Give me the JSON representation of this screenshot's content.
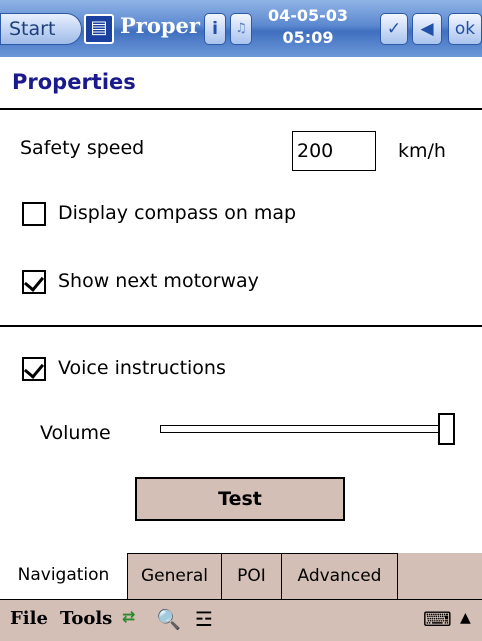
{
  "titlebar": {
    "start_label": "Start",
    "app_title": "Proper",
    "date": "04-05-03",
    "time": "05:09",
    "info_label": "i",
    "ok_label": "ok",
    "app_icon": "app-icon",
    "volume_icon": "speaker-icon",
    "back_icon": "back-arrow-icon",
    "check_icon": "tasks-icon"
  },
  "page": {
    "title": "Properties"
  },
  "settings": {
    "safety_speed_label": "Safety speed",
    "safety_speed_value": "200",
    "safety_speed_unit": "km/h",
    "display_compass_label": "Display compass on map",
    "display_compass_checked": false,
    "show_motorway_label": "Show next motorway",
    "show_motorway_checked": true,
    "voice_instructions_label": "Voice instructions",
    "voice_instructions_checked": true,
    "volume_label": "Volume",
    "volume_level": 1.0,
    "test_button_label": "Test"
  },
  "tabs": [
    {
      "label": "Navigation",
      "active": true
    },
    {
      "label": "General",
      "active": false
    },
    {
      "label": "POI",
      "active": false
    },
    {
      "label": "Advanced",
      "active": false
    }
  ],
  "menubar": {
    "file_label": "File",
    "tools_label": "Tools",
    "icons": [
      "ab-conversion-icon",
      "search-icon",
      "settings-sliders-icon",
      "keyboard-icon",
      "up-arrow-icon"
    ]
  }
}
